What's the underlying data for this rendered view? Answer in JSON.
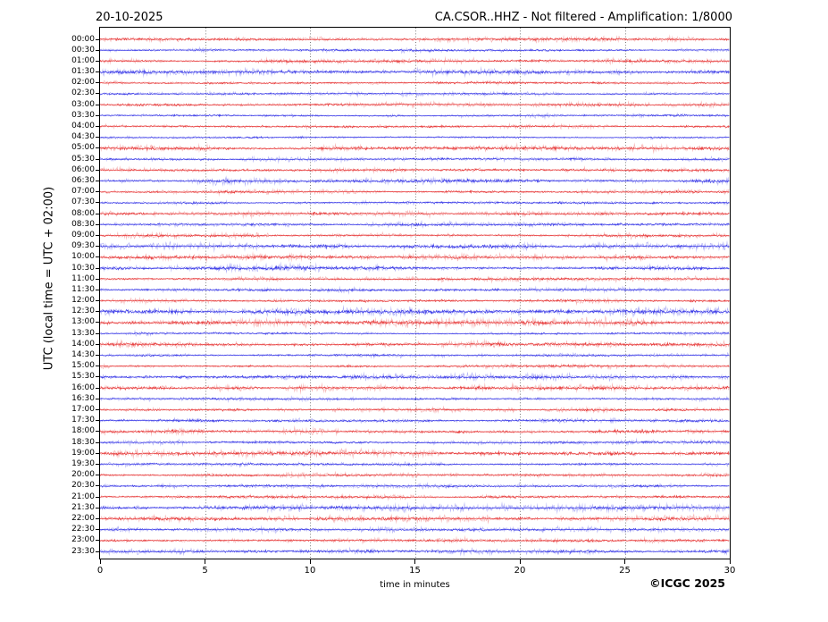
{
  "chart_data": {
    "type": "line",
    "kind": "helicorder-seismogram",
    "title_left": "20-10-2025",
    "title_right": "CA.CSOR..HHZ - Not filtered - Amplification: 1/8000",
    "ylabel": "UTC (local time = UTC + 02:00)",
    "xlabel": "time in minutes",
    "copyright": "©ICGC 2025",
    "x_range": [
      0,
      30
    ],
    "x_ticks": [
      0,
      5,
      10,
      15,
      20,
      25,
      30
    ],
    "grid_x": [
      5,
      10,
      15,
      20,
      25
    ],
    "grid_style": "dotted",
    "legend": "none",
    "colors": {
      "red": "#e62e2e",
      "blue": "#2e2ee6",
      "grid": "#6f6f6f",
      "frame": "#000000"
    },
    "rows": [
      {
        "time": "00:00",
        "color": "red",
        "amp": 1.0
      },
      {
        "time": "00:30",
        "color": "blue",
        "amp": 0.75
      },
      {
        "time": "01:00",
        "color": "red",
        "amp": 0.9
      },
      {
        "time": "01:30",
        "color": "blue",
        "amp": 1.25
      },
      {
        "time": "02:00",
        "color": "red",
        "amp": 0.9
      },
      {
        "time": "02:30",
        "color": "blue",
        "amp": 0.75
      },
      {
        "time": "03:00",
        "color": "red",
        "amp": 0.9
      },
      {
        "time": "03:30",
        "color": "blue",
        "amp": 0.8
      },
      {
        "time": "04:00",
        "color": "red",
        "amp": 0.9
      },
      {
        "time": "04:30",
        "color": "blue",
        "amp": 0.75
      },
      {
        "time": "05:00",
        "color": "red",
        "amp": 1.2
      },
      {
        "time": "05:30",
        "color": "blue",
        "amp": 0.9
      },
      {
        "time": "06:00",
        "color": "red",
        "amp": 0.9
      },
      {
        "time": "06:30",
        "color": "blue",
        "amp": 1.2
      },
      {
        "time": "07:00",
        "color": "red",
        "amp": 0.9
      },
      {
        "time": "07:30",
        "color": "blue",
        "amp": 0.75
      },
      {
        "time": "08:00",
        "color": "red",
        "amp": 1.0
      },
      {
        "time": "08:30",
        "color": "blue",
        "amp": 0.9
      },
      {
        "time": "09:00",
        "color": "red",
        "amp": 1.0
      },
      {
        "time": "09:30",
        "color": "blue",
        "amp": 1.3
      },
      {
        "time": "10:00",
        "color": "red",
        "amp": 1.2
      },
      {
        "time": "10:30",
        "color": "blue",
        "amp": 1.35
      },
      {
        "time": "11:00",
        "color": "red",
        "amp": 0.9
      },
      {
        "time": "11:30",
        "color": "blue",
        "amp": 0.9
      },
      {
        "time": "12:00",
        "color": "red",
        "amp": 0.9
      },
      {
        "time": "12:30",
        "color": "blue",
        "amp": 1.5
      },
      {
        "time": "13:00",
        "color": "red",
        "amp": 1.5
      },
      {
        "time": "13:30",
        "color": "blue",
        "amp": 0.75
      },
      {
        "time": "14:00",
        "color": "red",
        "amp": 1.2
      },
      {
        "time": "14:30",
        "color": "blue",
        "amp": 0.75
      },
      {
        "time": "15:00",
        "color": "red",
        "amp": 0.9
      },
      {
        "time": "15:30",
        "color": "blue",
        "amp": 1.2
      },
      {
        "time": "16:00",
        "color": "red",
        "amp": 1.2
      },
      {
        "time": "16:30",
        "color": "blue",
        "amp": 0.75
      },
      {
        "time": "17:00",
        "color": "red",
        "amp": 0.9
      },
      {
        "time": "17:30",
        "color": "blue",
        "amp": 0.9
      },
      {
        "time": "18:00",
        "color": "red",
        "amp": 1.2
      },
      {
        "time": "18:30",
        "color": "blue",
        "amp": 0.9
      },
      {
        "time": "19:00",
        "color": "red",
        "amp": 1.35
      },
      {
        "time": "19:30",
        "color": "blue",
        "amp": 0.75
      },
      {
        "time": "20:00",
        "color": "red",
        "amp": 0.9
      },
      {
        "time": "20:30",
        "color": "blue",
        "amp": 0.9
      },
      {
        "time": "21:00",
        "color": "red",
        "amp": 0.9
      },
      {
        "time": "21:30",
        "color": "blue",
        "amp": 1.35
      },
      {
        "time": "22:00",
        "color": "red",
        "amp": 1.2
      },
      {
        "time": "22:30",
        "color": "blue",
        "amp": 0.9
      },
      {
        "time": "23:00",
        "color": "red",
        "amp": 0.9
      },
      {
        "time": "23:30",
        "color": "blue",
        "amp": 1.1
      }
    ]
  }
}
